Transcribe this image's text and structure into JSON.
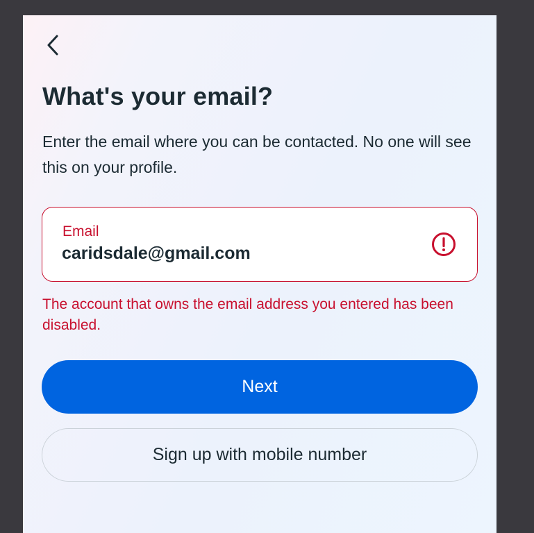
{
  "header": {
    "back_icon": "chevron-left-icon",
    "title": "What's your email?",
    "description": "Enter the email where you can be contacted. No one will see this on your profile."
  },
  "email_field": {
    "label": "Email",
    "value": "caridsdale@gmail.com",
    "status_icon": "alert-circle-icon",
    "error": "The account that owns the email address you entered has been disabled."
  },
  "actions": {
    "next_label": "Next",
    "mobile_label": "Sign up with mobile number"
  },
  "colors": {
    "page_background": "#3a393e",
    "primary": "#0064e0",
    "error": "#c8102e",
    "text": "#1c2b33",
    "outline_border": "#cbd2d9"
  }
}
